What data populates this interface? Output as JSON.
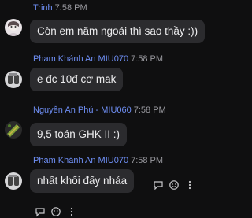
{
  "messages": [
    {
      "sender": "Trinh",
      "time": "7:58 PM",
      "text": "Còn em năm ngoái thì sao thầy :))"
    },
    {
      "sender": "Phạm Khánh An MIU070",
      "time": "7:58 PM",
      "text": "e đc 10đ cơ mak"
    },
    {
      "sender": "Nguyễn An Phú - MIU060",
      "time": "7:58 PM",
      "text": "9,5 toán GHK II :)"
    },
    {
      "sender": "Phạm Khánh An MIU070",
      "time": "7:58 PM",
      "text": "nhất khối đấy nháa"
    }
  ],
  "colors": {
    "background": "#0f0f10",
    "bubble": "#2b2b2e",
    "sender_name": "#6f8ff5",
    "timestamp": "#9a9aa0"
  },
  "icons": {
    "message_actions": [
      "reply-icon",
      "emoji-reaction-icon",
      "more-options-icon"
    ],
    "footer_actions": [
      "reply-icon",
      "emoji-reaction-icon",
      "more-options-icon"
    ]
  }
}
